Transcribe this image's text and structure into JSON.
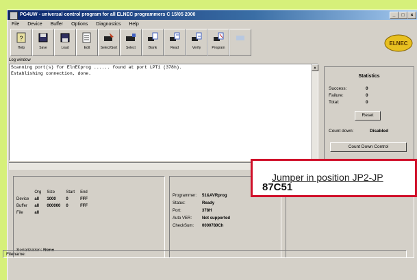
{
  "window": {
    "title": "PG4UW - universal control program for all ELNEC programmers    C 15/05 2000",
    "controls": [
      "_",
      "□",
      "×"
    ]
  },
  "menu": [
    "File",
    "Device",
    "Buffer",
    "Options",
    "Diagnostics",
    "Help"
  ],
  "toolbar": [
    {
      "label": "Help",
      "icon": "help-icon"
    },
    {
      "label": "Save",
      "icon": "save-icon"
    },
    {
      "label": "Load",
      "icon": "load-icon"
    },
    {
      "label": "Edit",
      "icon": "edit-icon"
    },
    {
      "label": "Select/Sort",
      "icon": "select-icon"
    },
    {
      "label": "Select",
      "icon": "chip-icon"
    },
    {
      "label": "Blank",
      "icon": "blank-icon"
    },
    {
      "label": "Read",
      "icon": "read-icon"
    },
    {
      "label": "Verify",
      "icon": "verify-icon"
    },
    {
      "label": "Program",
      "icon": "program-icon"
    },
    {
      "label": "",
      "icon": "disabled-icon"
    }
  ],
  "logo": "ELNEC",
  "log": {
    "label": "Log window",
    "lines": [
      "Scanning port(s) for ElnECprog ...... found at port LPT1 (378h).",
      "Establishing connection, done."
    ]
  },
  "statistics": {
    "title": "Statistics",
    "success_label": "Success:",
    "success": "0",
    "failure_label": "Failure:",
    "failure": "0",
    "total_label": "Total:",
    "total": "0",
    "reset": "Reset",
    "count_down_label": "Count down:",
    "count_down": "Disabled",
    "button2": "Count Down Control"
  },
  "ranges": {
    "headers": [
      "",
      "Org",
      "Size",
      "Start",
      "End"
    ],
    "rows": [
      [
        "Device",
        "all",
        "1000",
        "0",
        "FFF"
      ],
      [
        "Buffer",
        "all",
        "000000",
        "0",
        "FFF"
      ],
      [
        "File",
        "all",
        "",
        "",
        ""
      ]
    ],
    "serialization_label": "Serialization:",
    "serialization": "None"
  },
  "info": {
    "programmer_label": "Programmer:",
    "programmer": "51&AVRprog",
    "status_label": "Status:",
    "status": "Ready",
    "port_label": "Port:",
    "port": "378H",
    "auto_verify_label": "Auto VER:",
    "auto_verify": "Not supported",
    "checksum_label": "CheckSum:",
    "checksum": "0000780Ch"
  },
  "filename_label": "Filename:",
  "callout": {
    "line1": "Jumper in position JP2-JP",
    "line2": "87C51"
  }
}
